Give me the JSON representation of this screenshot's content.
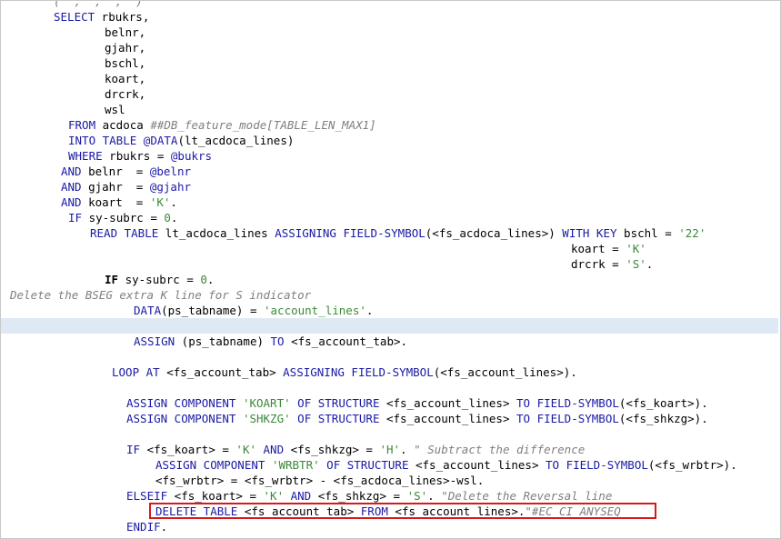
{
  "editor": {
    "highlighted_line": 32,
    "lines": [
      [
        {
          "t": "(  ,  ,  ,  ) ",
          "c": "cmt"
        }
      ],
      [
        {
          "t": "SELECT",
          "c": "kw"
        },
        {
          "t": " rbukrs,",
          "c": ""
        }
      ],
      [
        {
          "t": "belnr,",
          "c": ""
        }
      ],
      [
        {
          "t": "gjahr,",
          "c": ""
        }
      ],
      [
        {
          "t": "bschl,",
          "c": ""
        }
      ],
      [
        {
          "t": "koart,",
          "c": ""
        }
      ],
      [
        {
          "t": "drcrk,",
          "c": ""
        }
      ],
      [
        {
          "t": "wsl",
          "c": ""
        }
      ],
      [
        {
          "t": "FROM",
          "c": "kw"
        },
        {
          "t": " acdoca ",
          "c": ""
        },
        {
          "t": "##DB_feature_mode[TABLE_LEN_MAX1]",
          "c": "cmt"
        }
      ],
      [
        {
          "t": "INTO TABLE",
          "c": "kw"
        },
        {
          "t": " ",
          "c": ""
        },
        {
          "t": "@DATA",
          "c": "kw"
        },
        {
          "t": "(lt_acdoca_lines)",
          "c": ""
        }
      ],
      [
        {
          "t": "WHERE",
          "c": "kw"
        },
        {
          "t": " rbukrs = ",
          "c": ""
        },
        {
          "t": "@bukrs",
          "c": "kw"
        }
      ],
      [
        {
          "t": "AND",
          "c": "kw"
        },
        {
          "t": " belnr  = ",
          "c": ""
        },
        {
          "t": "@belnr",
          "c": "kw"
        }
      ],
      [
        {
          "t": "AND",
          "c": "kw"
        },
        {
          "t": " gjahr  = ",
          "c": ""
        },
        {
          "t": "@gjahr",
          "c": "kw"
        }
      ],
      [
        {
          "t": "AND",
          "c": "kw"
        },
        {
          "t": " koart  = ",
          "c": ""
        },
        {
          "t": "'K'",
          "c": "str"
        },
        {
          "t": ".",
          "c": ""
        }
      ],
      [
        {
          "t": "IF",
          "c": "kw"
        },
        {
          "t": " sy-subrc = ",
          "c": ""
        },
        {
          "t": "0",
          "c": "num"
        },
        {
          "t": ".",
          "c": ""
        }
      ],
      [
        {
          "t": "READ TABLE",
          "c": "kw"
        },
        {
          "t": " lt_acdoca_lines ",
          "c": ""
        },
        {
          "t": "ASSIGNING FIELD-SYMBOL",
          "c": "kw"
        },
        {
          "t": "(<fs_acdoca_lines>) ",
          "c": ""
        },
        {
          "t": "WITH KEY",
          "c": "kw"
        },
        {
          "t": " bschl = ",
          "c": ""
        },
        {
          "t": "'22'",
          "c": "str"
        }
      ],
      [
        {
          "t": "koart = ",
          "c": ""
        },
        {
          "t": "'K'",
          "c": "str"
        }
      ],
      [
        {
          "t": "drcrk = ",
          "c": ""
        },
        {
          "t": "'S'",
          "c": "str"
        },
        {
          "t": ".",
          "c": ""
        }
      ],
      [
        {
          "t": "IF",
          "c": "bold"
        },
        {
          "t": " sy-subrc = ",
          "c": ""
        },
        {
          "t": "0",
          "c": "num"
        },
        {
          "t": ".",
          "c": ""
        }
      ],
      [
        {
          "t": "Delete the BSEG extra K line for S indicator",
          "c": "cmt"
        }
      ],
      [
        {
          "t": "DATA",
          "c": "kw"
        },
        {
          "t": "(ps_tabname) = ",
          "c": ""
        },
        {
          "t": "'account_lines'",
          "c": "str"
        },
        {
          "t": ".",
          "c": ""
        }
      ],
      [
        {
          "t": "",
          "c": ""
        }
      ],
      [
        {
          "t": "ASSIGN",
          "c": "kw"
        },
        {
          "t": " (ps_tabname) ",
          "c": ""
        },
        {
          "t": "TO",
          "c": "kw"
        },
        {
          "t": " <fs_account_tab>.",
          "c": ""
        }
      ],
      [
        {
          "t": "LOOP AT",
          "c": "kw"
        },
        {
          "t": " <fs_account_tab> ",
          "c": ""
        },
        {
          "t": "ASSIGNING FIELD-SYMBOL",
          "c": "kw"
        },
        {
          "t": "(<fs_account_lines>).",
          "c": ""
        }
      ],
      [
        {
          "t": "ASSIGN COMPONENT",
          "c": "kw"
        },
        {
          "t": " ",
          "c": ""
        },
        {
          "t": "'KOART'",
          "c": "str"
        },
        {
          "t": " ",
          "c": ""
        },
        {
          "t": "OF STRUCTURE",
          "c": "kw"
        },
        {
          "t": " <fs_account_lines> ",
          "c": ""
        },
        {
          "t": "TO FIELD-SYMBOL",
          "c": "kw"
        },
        {
          "t": "(<fs_koart>).",
          "c": ""
        }
      ],
      [
        {
          "t": "ASSIGN COMPONENT",
          "c": "kw"
        },
        {
          "t": " ",
          "c": ""
        },
        {
          "t": "'SHKZG'",
          "c": "str"
        },
        {
          "t": " ",
          "c": ""
        },
        {
          "t": "OF STRUCTURE",
          "c": "kw"
        },
        {
          "t": " <fs_account_lines> ",
          "c": ""
        },
        {
          "t": "TO FIELD-SYMBOL",
          "c": "kw"
        },
        {
          "t": "(<fs_shkzg>).",
          "c": ""
        }
      ],
      [
        {
          "t": "IF",
          "c": "kw"
        },
        {
          "t": " <fs_koart> = ",
          "c": ""
        },
        {
          "t": "'K'",
          "c": "str"
        },
        {
          "t": " ",
          "c": ""
        },
        {
          "t": "AND",
          "c": "kw"
        },
        {
          "t": " <fs_shkzg> = ",
          "c": ""
        },
        {
          "t": "'H'",
          "c": "str"
        },
        {
          "t": ". ",
          "c": ""
        },
        {
          "t": "\" Subtract the difference",
          "c": "cmt"
        }
      ],
      [
        {
          "t": "ASSIGN COMPONENT",
          "c": "kw"
        },
        {
          "t": " ",
          "c": ""
        },
        {
          "t": "'WRBTR'",
          "c": "str"
        },
        {
          "t": " ",
          "c": ""
        },
        {
          "t": "OF STRUCTURE",
          "c": "kw"
        },
        {
          "t": " <fs_account_lines> ",
          "c": ""
        },
        {
          "t": "TO FIELD-SYMBOL",
          "c": "kw"
        },
        {
          "t": "(<fs_wrbtr>).",
          "c": ""
        }
      ],
      [
        {
          "t": "<fs_wrbtr> = <fs_wrbtr> - <fs_acdoca_lines>-wsl.",
          "c": ""
        }
      ],
      [
        {
          "t": "ELSEIF",
          "c": "kw"
        },
        {
          "t": " <fs_koart> = ",
          "c": ""
        },
        {
          "t": "'K'",
          "c": "str"
        },
        {
          "t": " ",
          "c": ""
        },
        {
          "t": "AND",
          "c": "kw"
        },
        {
          "t": " <fs_shkzg> = ",
          "c": ""
        },
        {
          "t": "'S'",
          "c": "str"
        },
        {
          "t": ". ",
          "c": ""
        },
        {
          "t": "\"Delete the Reversal line",
          "c": "cmt"
        }
      ],
      [
        {
          "t": "DELETE TABLE",
          "c": "kw"
        },
        {
          "t": " <fs_account_tab> ",
          "c": ""
        },
        {
          "t": "FROM",
          "c": "kw"
        },
        {
          "t": " <fs_account_lines>.",
          "c": ""
        },
        {
          "t": "\"#EC CI_ANYSEQ",
          "c": "cmt"
        }
      ],
      [
        {
          "t": "ENDIF",
          "c": "kw"
        },
        {
          "t": ".",
          "c": ""
        }
      ]
    ]
  }
}
